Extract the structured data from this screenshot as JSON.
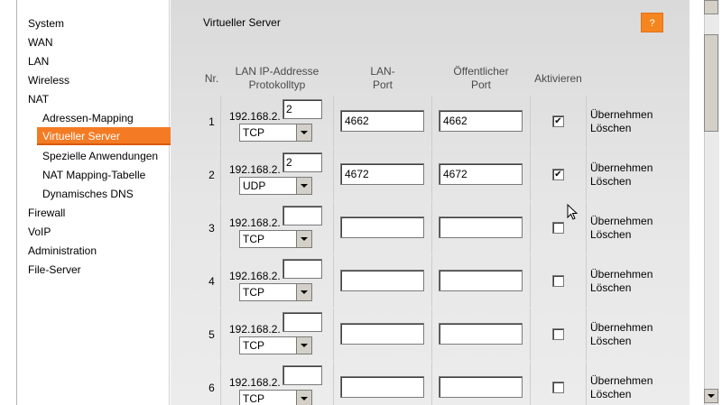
{
  "sidebar": {
    "items": [
      {
        "label": "System"
      },
      {
        "label": "WAN"
      },
      {
        "label": "LAN"
      },
      {
        "label": "Wireless"
      },
      {
        "label": "NAT"
      },
      {
        "label": "Adressen-Mapping"
      },
      {
        "label": "Virtueller Server",
        "active": true
      },
      {
        "label": "Spezielle Anwendungen"
      },
      {
        "label": "NAT Mapping-Tabelle"
      },
      {
        "label": "Dynamisches DNS"
      },
      {
        "label": "Firewall"
      },
      {
        "label": "VoIP"
      },
      {
        "label": "Administration"
      },
      {
        "label": "File-Server"
      }
    ]
  },
  "page": {
    "title": "Virtueller Server",
    "help_label": "?"
  },
  "table": {
    "headers": {
      "nr": "Nr.",
      "ip_line1": "LAN IP-Addresse",
      "ip_line2": "Protokolltyp",
      "lan_line1": "LAN-",
      "lan_line2": "Port",
      "pub_line1": "Öffentlicher",
      "pub_line2": "Port",
      "activate": "Aktivieren"
    },
    "apply_label": "Übernehmen",
    "delete_label": "Löschen",
    "rows": [
      {
        "nr": "1",
        "ip_prefix": "192.168.2.",
        "ip_last": "2",
        "protocol": "TCP",
        "lan_port": "4662",
        "public_port": "4662",
        "active": "✔"
      },
      {
        "nr": "2",
        "ip_prefix": "192.168.2.",
        "ip_last": "2",
        "protocol": "UDP",
        "lan_port": "4672",
        "public_port": "4672",
        "active": "✔"
      },
      {
        "nr": "3",
        "ip_prefix": "192.168.2.",
        "ip_last": "",
        "protocol": "TCP",
        "lan_port": "",
        "public_port": "",
        "active": ""
      },
      {
        "nr": "4",
        "ip_prefix": "192.168.2.",
        "ip_last": "",
        "protocol": "TCP",
        "lan_port": "",
        "public_port": "",
        "active": ""
      },
      {
        "nr": "5",
        "ip_prefix": "192.168.2.",
        "ip_last": "",
        "protocol": "TCP",
        "lan_port": "",
        "public_port": "",
        "active": ""
      },
      {
        "nr": "6",
        "ip_prefix": "192.168.2.",
        "ip_last": "",
        "protocol": "TCP",
        "lan_port": "",
        "public_port": "",
        "active": ""
      }
    ]
  }
}
